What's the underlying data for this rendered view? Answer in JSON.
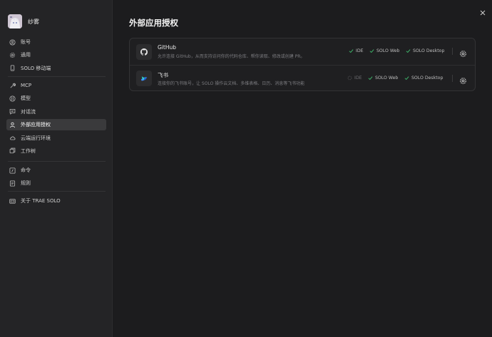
{
  "window": {
    "close_label": "×"
  },
  "profile": {
    "name": "纱雾"
  },
  "sidebar": {
    "group1": [
      {
        "label": "账号",
        "icon": "account-icon"
      },
      {
        "label": "通用",
        "icon": "gear-icon"
      },
      {
        "label": "SOLO 移动端",
        "icon": "mobile-icon"
      }
    ],
    "group2": [
      {
        "label": "MCP",
        "icon": "tool-icon"
      },
      {
        "label": "模型",
        "icon": "model-icon"
      },
      {
        "label": "对话流",
        "icon": "chat-icon"
      },
      {
        "label": "外部应用授权",
        "icon": "user-auth-icon",
        "active": true
      },
      {
        "label": "云端运行环境",
        "icon": "cloud-icon"
      },
      {
        "label": "工作树",
        "icon": "worktree-icon"
      }
    ],
    "group3": [
      {
        "label": "命令",
        "icon": "command-icon"
      },
      {
        "label": "规则",
        "icon": "rules-icon"
      }
    ],
    "group4": [
      {
        "label": "关于 TRAE SOLO",
        "icon": "about-icon"
      }
    ]
  },
  "main": {
    "title": "外部应用授权",
    "apps": [
      {
        "name": "GitHub",
        "description": "允许连接 GitHub，从而支持访问你的代码仓库、帮你读取、修改或创建 PR。",
        "icon": "github-icon",
        "scopes": [
          {
            "label": "IDE",
            "enabled": true
          },
          {
            "label": "SOLO Web",
            "enabled": true
          },
          {
            "label": "SOLO Desktop",
            "enabled": true
          }
        ]
      },
      {
        "name": "飞书",
        "description": "连接你的飞书账号，让 SOLO 操作云文档、多维表格、日历、消息等飞书功能",
        "icon": "feishu-icon",
        "scopes": [
          {
            "label": "IDE",
            "enabled": false
          },
          {
            "label": "SOLO Web",
            "enabled": true
          },
          {
            "label": "SOLO Desktop",
            "enabled": true
          }
        ]
      }
    ]
  },
  "colors": {
    "accent_check": "#3fb56b",
    "active_nav": "#3a3a3c",
    "background": "#1c1c1e"
  }
}
